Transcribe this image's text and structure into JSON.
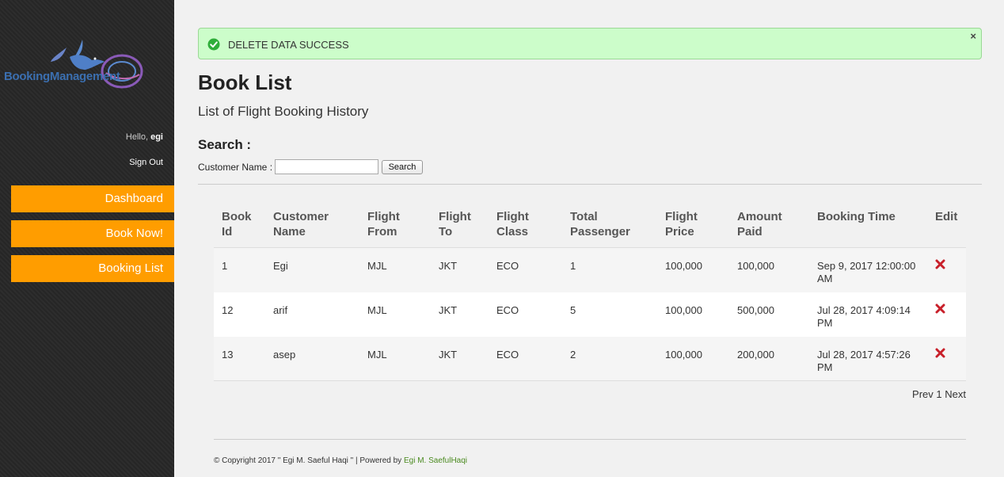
{
  "sidebar": {
    "logo_text": "BookingManagement",
    "hello_prefix": "Hello, ",
    "user_name": "egi",
    "sign_out": "Sign Out",
    "nav": [
      {
        "label": "Dashboard"
      },
      {
        "label": "Book Now!"
      },
      {
        "label": "Booking List"
      }
    ]
  },
  "alert": {
    "message": "DELETE DATA SUCCESS",
    "close": "×"
  },
  "page": {
    "title": "Book List",
    "subtitle": "List of Flight Booking History"
  },
  "search": {
    "heading": "Search :",
    "label": "Customer Name :",
    "value": "",
    "button": "Search"
  },
  "table": {
    "headers": [
      {
        "line1": "Book",
        "line2": "Id"
      },
      {
        "line1": "Customer",
        "line2": "Name"
      },
      {
        "line1": "Flight",
        "line2": "From"
      },
      {
        "line1": "Flight",
        "line2": "To"
      },
      {
        "line1": "Flight",
        "line2": "Class"
      },
      {
        "line1": "Total",
        "line2": "Passenger"
      },
      {
        "line1": "Flight",
        "line2": "Price"
      },
      {
        "line1": "Amount",
        "line2": "Paid"
      },
      {
        "line1": "Booking Time",
        "line2": ""
      },
      {
        "line1": "Edit",
        "line2": ""
      }
    ],
    "rows": [
      {
        "id": "1",
        "customer": "Egi",
        "from": "MJL",
        "to": "JKT",
        "class": "ECO",
        "passenger": "1",
        "price": "100,000",
        "paid": "100,000",
        "time": "Sep 9, 2017 12:00:00 AM"
      },
      {
        "id": "12",
        "customer": "arif",
        "from": "MJL",
        "to": "JKT",
        "class": "ECO",
        "passenger": "5",
        "price": "100,000",
        "paid": "500,000",
        "time": "Jul 28, 2017 4:09:14 PM"
      },
      {
        "id": "13",
        "customer": "asep",
        "from": "MJL",
        "to": "JKT",
        "class": "ECO",
        "passenger": "2",
        "price": "100,000",
        "paid": "200,000",
        "time": "Jul 28, 2017 4:57:26 PM"
      }
    ]
  },
  "pagination": {
    "prev": "Prev",
    "page": "1",
    "next": "Next"
  },
  "footer": {
    "text": "© Copyright 2017 \" Egi M. Saeful Haqi \" | Powered by ",
    "link": "Egi M. SaefulHaqi"
  },
  "colors": {
    "accent": "#ff9d00",
    "alert_bg": "#ccfdca",
    "delete_icon": "#c8202a",
    "footer_link": "#4a8a1f"
  }
}
